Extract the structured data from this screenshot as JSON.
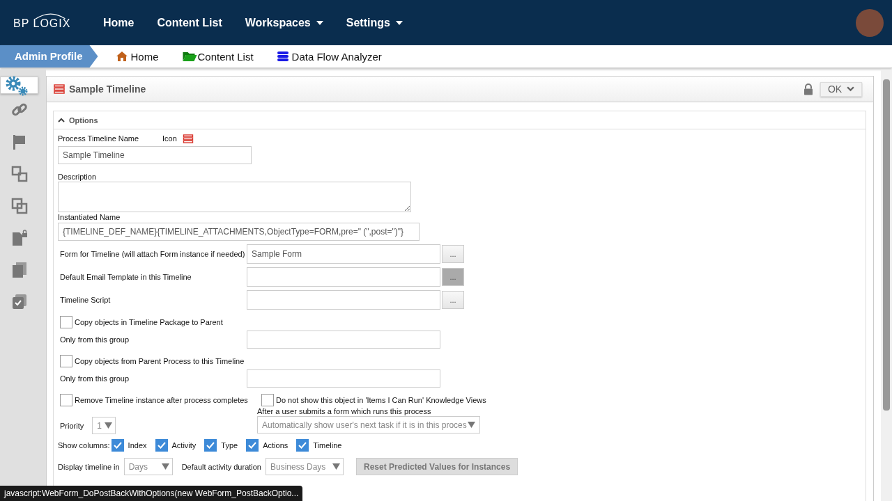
{
  "top_nav": {
    "logo": "BP LOGIX",
    "items": [
      {
        "label": "Home",
        "has_menu": false
      },
      {
        "label": "Content List",
        "has_menu": false
      },
      {
        "label": "Workspaces",
        "has_menu": true
      },
      {
        "label": "Settings",
        "has_menu": true
      }
    ]
  },
  "breadcrumb": {
    "profile": "Admin Profile",
    "links": [
      {
        "label": "Home"
      },
      {
        "label": "Content List"
      },
      {
        "label": "Data Flow Analyzer"
      }
    ]
  },
  "sidebar": {
    "items": [
      {
        "selected": true
      },
      {
        "selected": false
      },
      {
        "selected": false
      },
      {
        "selected": false
      },
      {
        "selected": false
      },
      {
        "selected": false
      },
      {
        "selected": false
      },
      {
        "selected": false
      }
    ]
  },
  "panel": {
    "title": "Sample Timeline",
    "ok_button": "OK",
    "locked": true
  },
  "section": {
    "title": "Options",
    "expanded": true
  },
  "name_field": {
    "label": "Process Timeline Name",
    "icon_label": "Icon",
    "value": "Sample Timeline"
  },
  "description": {
    "label": "Description"
  },
  "instantiated_name": {
    "label": "Instantiated Name",
    "value": "{TIMELINE_DEF_NAME}{TIMELINE_ATTACHMENTS,ObjectType=FORM,pre=\" (\",post=\")\"}"
  },
  "picker_rows": [
    {
      "label": "Form for Timeline (will attach Form instance if needed)",
      "value": "Sample Form",
      "button": "...",
      "hovered": false
    },
    {
      "label": "Default Email Template in this Timeline",
      "button": "...",
      "hovered": true
    },
    {
      "label": "Timeline Script",
      "button": "...",
      "hovered": false
    }
  ],
  "copy_options": [
    {
      "label": "Copy objects in Timeline Package to Parent",
      "checked": false,
      "group_label": "Only from this group"
    },
    {
      "label": "Copy objects from Parent Process to this Timeline",
      "checked": false,
      "group_label": "Only from this group"
    }
  ],
  "remove_option": {
    "label": "Remove Timeline instance after process completes",
    "checked": false
  },
  "hide_option": {
    "label": "Do not show this object in 'Items I Can Run' Knowledge Views",
    "checked": false
  },
  "priority": {
    "label": "Priority",
    "value": "1"
  },
  "after_submit": {
    "label": "After a user submits a form which runs this process",
    "value": "Automatically show user's next task if it is in this proces"
  },
  "show_columns": {
    "label": "Show columns:",
    "columns": [
      {
        "label": "Index",
        "checked": true
      },
      {
        "label": "Activity",
        "checked": true
      },
      {
        "label": "Type",
        "checked": true
      },
      {
        "label": "Actions",
        "checked": true
      },
      {
        "label": "Timeline",
        "checked": true
      }
    ]
  },
  "display_in": {
    "label": "Display timeline in",
    "value": "Days"
  },
  "duration": {
    "label": "Default activity duration",
    "value": "Business Days"
  },
  "reset_button": "Reset Predicted Values for Instances",
  "status_bar": "javascript:WebForm_DoPostBackWithOptions(new WebForm_PostBackOptio..."
}
